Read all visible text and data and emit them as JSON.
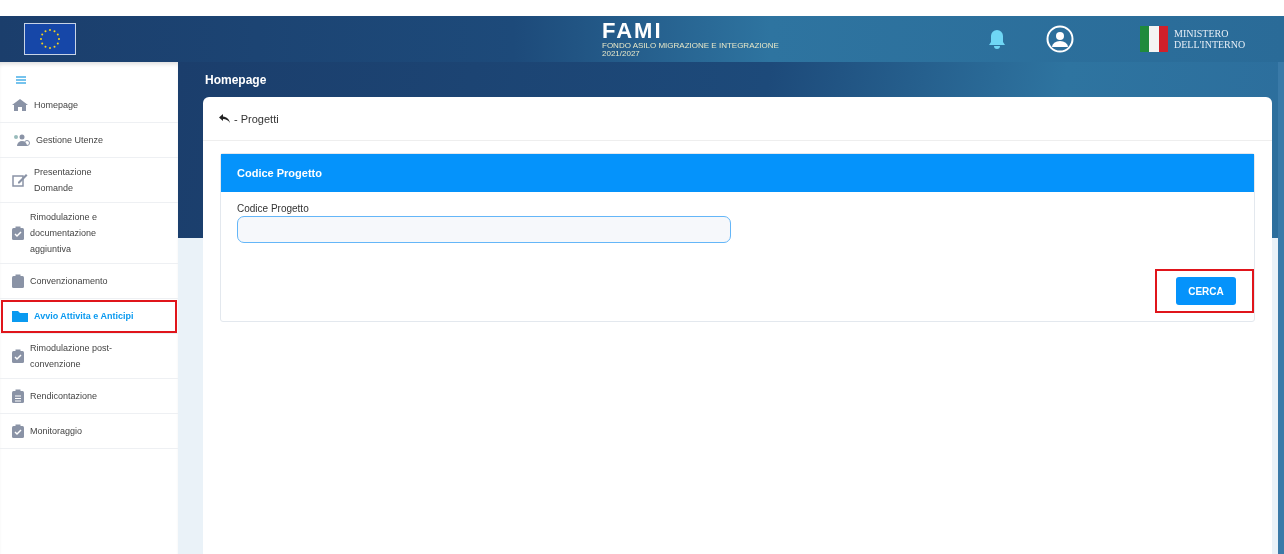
{
  "header": {
    "logo_title": "FAMI",
    "logo_subtitle": "FONDO ASILO MIGRAZIONE E INTEGRAZIONE 2021/2027",
    "ministry": [
      "MINISTERO",
      "DELL'INTERNO"
    ]
  },
  "sidebar": {
    "items": [
      {
        "label": "Homepage",
        "kind": "home",
        "selected": false,
        "highlighted": false
      },
      {
        "label": "Gestione Utenze",
        "kind": "users",
        "selected": false,
        "highlighted": false
      },
      {
        "label": "Presentazione Domande",
        "kind": "edit",
        "selected": false,
        "highlighted": false
      },
      {
        "label": "Rimodulazione e documentazione aggiuntiva",
        "kind": "check",
        "selected": false,
        "highlighted": false
      },
      {
        "label": "Convenzionamento",
        "kind": "clipboard",
        "selected": false,
        "highlighted": false
      },
      {
        "label": "Avvio Attivita e Anticipi",
        "kind": "folder",
        "selected": true,
        "highlighted": true
      },
      {
        "label": "Rimodulazione post-convenzione",
        "kind": "check",
        "selected": false,
        "highlighted": false
      },
      {
        "label": "Rendicontazione",
        "kind": "list",
        "selected": false,
        "highlighted": false
      },
      {
        "label": "Monitoraggio",
        "kind": "check",
        "selected": false,
        "highlighted": false
      }
    ]
  },
  "page_title": "Homepage",
  "breadcrumb": "- Progetti",
  "panel": {
    "title": "Codice Progetto",
    "field": {
      "label": "Codice Progetto"
    },
    "button": {
      "label": "CERCA",
      "highlighted": true
    }
  }
}
